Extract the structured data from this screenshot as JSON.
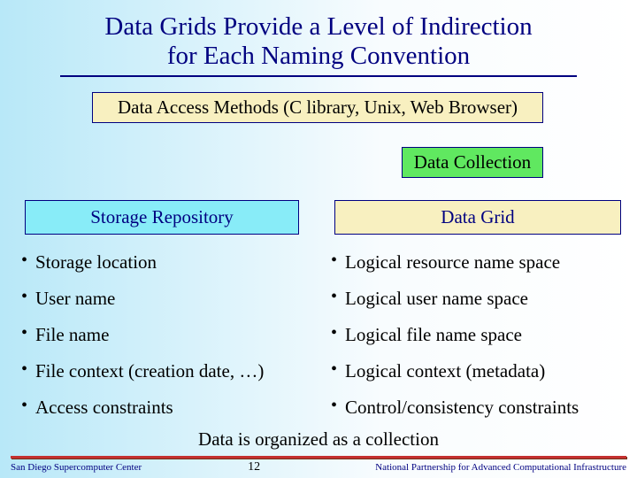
{
  "title_line1": "Data Grids Provide a Level of Indirection",
  "title_line2": "for Each Naming Convention",
  "boxes": {
    "access": "Data Access Methods (C library, Unix, Web Browser)",
    "collection": "Data Collection",
    "repo": "Storage Repository",
    "grid": "Data Grid"
  },
  "left_items": [
    "Storage location",
    "User name",
    "File name",
    "File context (creation date, …)",
    "Access constraints"
  ],
  "right_items": [
    "Logical resource name space",
    "Logical user name space",
    "Logical file name space",
    "Logical context (metadata)",
    "Control/consistency constraints"
  ],
  "bottom": "Data is organized as a collection",
  "footer": {
    "left": "San Diego Supercomputer Center",
    "page": "12",
    "right": "National Partnership for Advanced Computational Infrastructure"
  }
}
